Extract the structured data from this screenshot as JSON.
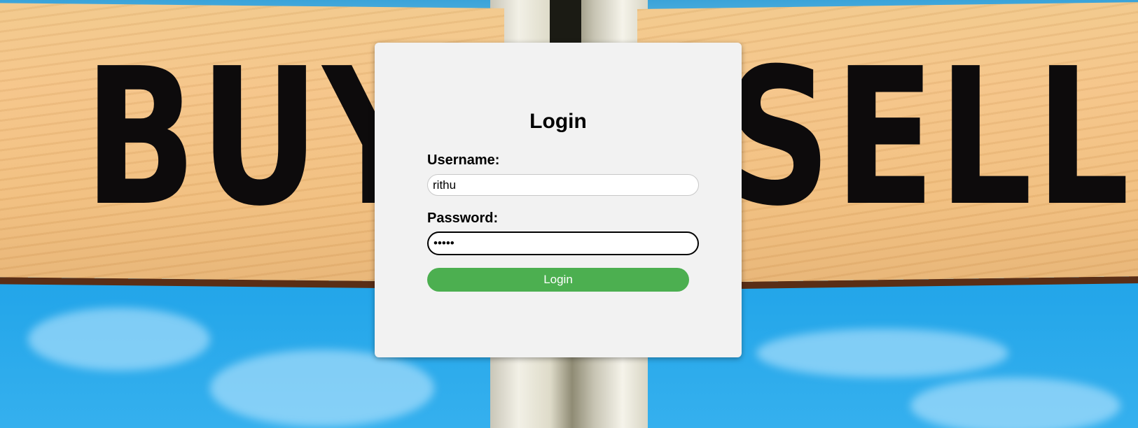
{
  "background": {
    "sign_left_text": "BUY",
    "sign_right_text": "SELL"
  },
  "login": {
    "title": "Login",
    "username_label": "Username:",
    "username_value": "rithu",
    "password_label": "Password:",
    "password_value": "rithu",
    "button_label": "Login"
  },
  "colors": {
    "button_bg": "#4caf50",
    "card_bg": "#f2f2f2"
  }
}
